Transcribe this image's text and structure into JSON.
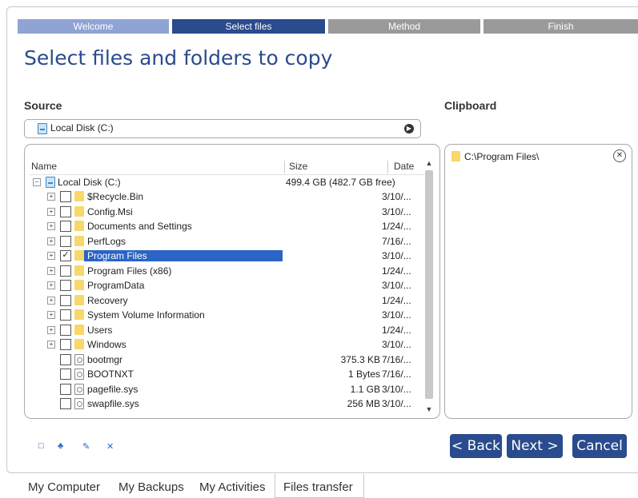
{
  "steps": [
    {
      "label": "Welcome",
      "color": "#8fa3d4"
    },
    {
      "label": "Select files",
      "color": "#2a4b8d"
    },
    {
      "label": "Method",
      "color": "#9a9a9a"
    },
    {
      "label": "Finish",
      "color": "#9a9a9a"
    }
  ],
  "title": "Select files and folders to copy",
  "source": {
    "label": "Source",
    "dropdown_value": "Local Disk (C:)"
  },
  "clipboard": {
    "label": "Clipboard",
    "items": [
      {
        "label": "C:\\Program Files\\"
      }
    ]
  },
  "tree": {
    "columns": {
      "name": "Name",
      "size": "Size",
      "date": "Date"
    },
    "root": {
      "label": "Local Disk (C:)",
      "size": "499.4 GB (482.7 GB free)"
    },
    "rows": [
      {
        "label": "$Recycle.Bin",
        "type": "folder",
        "expandable": true,
        "checked": false,
        "size": "",
        "date": "3/10/..."
      },
      {
        "label": "Config.Msi",
        "type": "folder",
        "expandable": true,
        "checked": false,
        "size": "",
        "date": "3/10/..."
      },
      {
        "label": "Documents and Settings",
        "type": "folder",
        "expandable": true,
        "checked": false,
        "size": "",
        "date": "1/24/..."
      },
      {
        "label": "PerfLogs",
        "type": "folder",
        "expandable": true,
        "checked": false,
        "size": "",
        "date": "7/16/..."
      },
      {
        "label": "Program Files",
        "type": "folder",
        "expandable": true,
        "checked": true,
        "selected": true,
        "size": "",
        "date": "3/10/..."
      },
      {
        "label": "Program Files (x86)",
        "type": "folder",
        "expandable": true,
        "checked": false,
        "size": "",
        "date": "1/24/..."
      },
      {
        "label": "ProgramData",
        "type": "folder",
        "expandable": true,
        "checked": false,
        "size": "",
        "date": "3/10/..."
      },
      {
        "label": "Recovery",
        "type": "folder",
        "expandable": true,
        "checked": false,
        "size": "",
        "date": "1/24/..."
      },
      {
        "label": "System Volume Information",
        "type": "folder",
        "expandable": true,
        "checked": false,
        "size": "",
        "date": "3/10/..."
      },
      {
        "label": "Users",
        "type": "folder",
        "expandable": true,
        "checked": false,
        "size": "",
        "date": "1/24/..."
      },
      {
        "label": "Windows",
        "type": "folder",
        "expandable": true,
        "checked": false,
        "size": "",
        "date": "3/10/..."
      },
      {
        "label": "bootmgr",
        "type": "file",
        "expandable": false,
        "checked": false,
        "size": "375.3 KB",
        "date": "7/16/..."
      },
      {
        "label": "BOOTNXT",
        "type": "file",
        "expandable": false,
        "checked": false,
        "size": "1 Bytes",
        "date": "7/16/..."
      },
      {
        "label": "pagefile.sys",
        "type": "file",
        "expandable": false,
        "checked": false,
        "size": "1.1 GB",
        "date": "3/10/..."
      },
      {
        "label": "swapfile.sys",
        "type": "file",
        "expandable": false,
        "checked": false,
        "size": "256 MB",
        "date": "3/10/..."
      }
    ]
  },
  "toolbar_icons": [
    "new-folder-icon",
    "network-icon",
    "rename-icon",
    "delete-icon"
  ],
  "buttons": {
    "back": "< Back",
    "next": "Next >",
    "cancel": "Cancel"
  },
  "bottom_tabs": [
    "My Computer",
    "My Backups",
    "My Activities",
    "Files transfer"
  ],
  "active_tab": "Files transfer"
}
